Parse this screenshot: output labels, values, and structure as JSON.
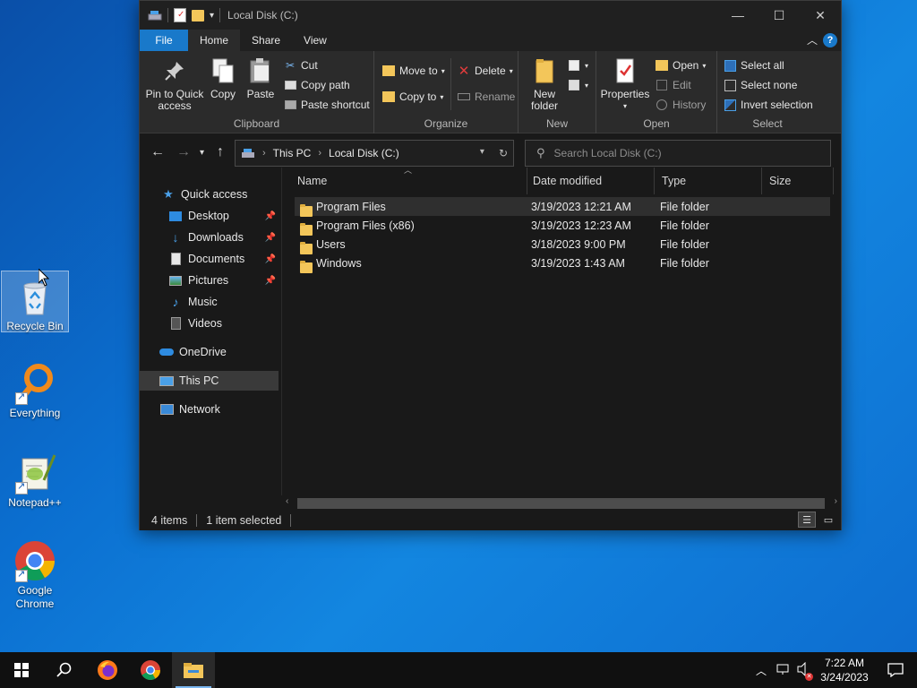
{
  "desktop": {
    "icons": [
      {
        "label": "Recycle Bin"
      },
      {
        "label": "Everything"
      },
      {
        "label": "Notepad++"
      },
      {
        "label": "Google Chrome"
      }
    ]
  },
  "window": {
    "title": "Local Disk (C:)",
    "tabs": [
      "File",
      "Home",
      "Share",
      "View"
    ],
    "ribbon": {
      "clipboard": {
        "label": "Clipboard",
        "pin": "Pin to Quick access",
        "copy": "Copy",
        "paste": "Paste",
        "cut": "Cut",
        "copy_path": "Copy path",
        "paste_shortcut": "Paste shortcut"
      },
      "organize": {
        "label": "Organize",
        "move_to": "Move to",
        "copy_to": "Copy to",
        "delete": "Delete",
        "rename": "Rename"
      },
      "new": {
        "label": "New",
        "new_folder": "New folder"
      },
      "open": {
        "label": "Open",
        "properties": "Properties",
        "open": "Open",
        "edit": "Edit",
        "history": "History"
      },
      "select": {
        "label": "Select",
        "select_all": "Select all",
        "select_none": "Select none",
        "invert": "Invert selection"
      }
    },
    "address": {
      "crumbs": [
        "This PC",
        "Local Disk (C:)"
      ]
    },
    "search": {
      "placeholder": "Search Local Disk (C:)"
    },
    "nav": {
      "quick_access": "Quick access",
      "desktop": "Desktop",
      "downloads": "Downloads",
      "documents": "Documents",
      "pictures": "Pictures",
      "music": "Music",
      "videos": "Videos",
      "onedrive": "OneDrive",
      "this_pc": "This PC",
      "network": "Network"
    },
    "columns": {
      "name": "Name",
      "date": "Date modified",
      "type": "Type",
      "size": "Size"
    },
    "files": [
      {
        "name": "Program Files",
        "date": "3/19/2023 12:21 AM",
        "type": "File folder"
      },
      {
        "name": "Program Files (x86)",
        "date": "3/19/2023 12:23 AM",
        "type": "File folder"
      },
      {
        "name": "Users",
        "date": "3/18/2023 9:00 PM",
        "type": "File folder"
      },
      {
        "name": "Windows",
        "date": "3/19/2023 1:43 AM",
        "type": "File folder"
      }
    ],
    "status": {
      "count": "4 items",
      "selected": "1 item selected"
    }
  },
  "taskbar": {
    "time": "7:22 AM",
    "date": "3/24/2023"
  },
  "colors": {
    "accent": "#1979ca",
    "folder": "#f3c65a"
  }
}
